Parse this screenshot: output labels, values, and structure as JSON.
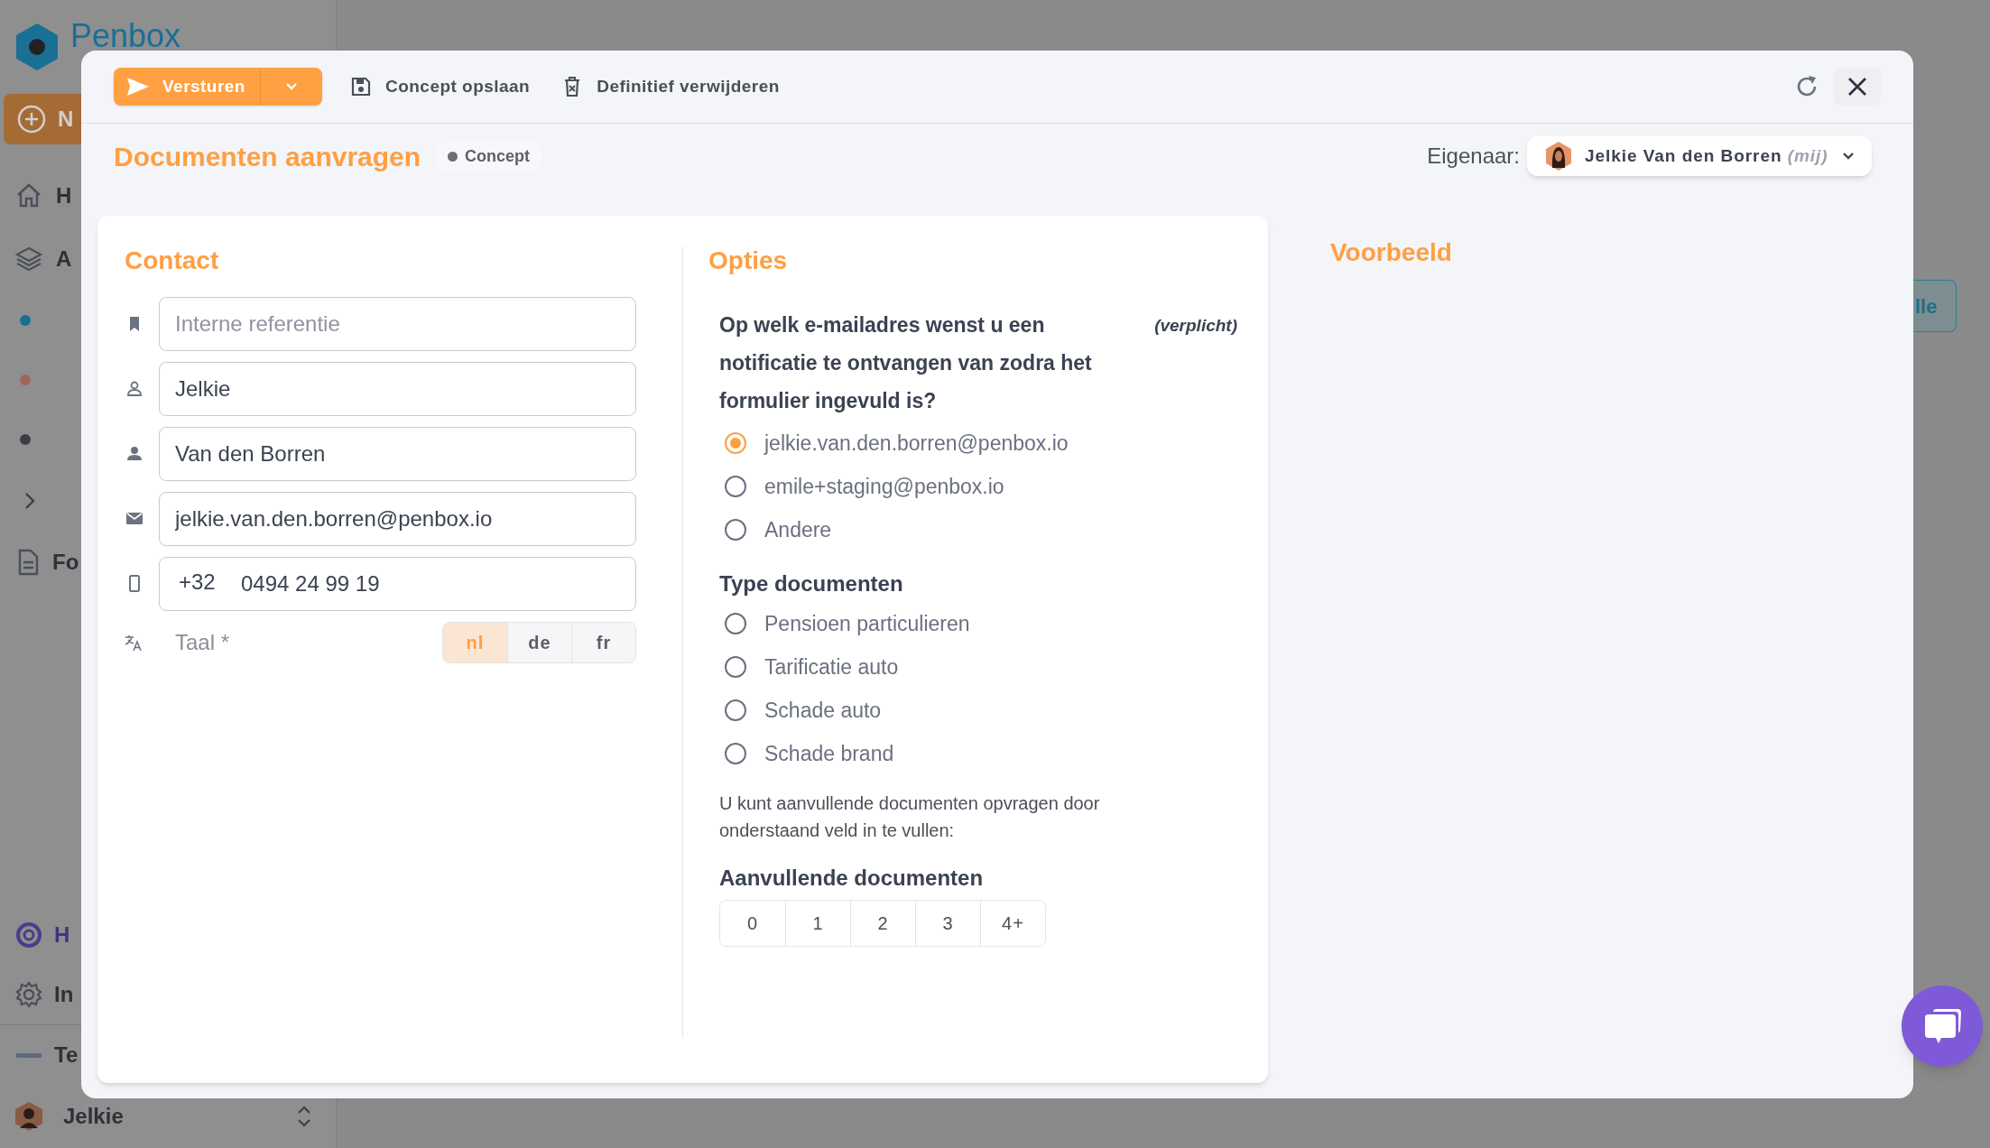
{
  "background": {
    "logo_text": "Penbox",
    "new_button": "N",
    "nav": [
      {
        "label": "H"
      },
      {
        "label": "A"
      }
    ],
    "sub_items": [
      {
        "color": "#1a6f94"
      },
      {
        "color": "#a0655a"
      },
      {
        "color": "#3b3f48"
      }
    ],
    "nav_bottom": [
      {
        "label": "Fo"
      }
    ],
    "footer_nav": [
      {
        "label": "H"
      },
      {
        "label": "In"
      },
      {
        "label": "Te"
      }
    ],
    "user": "Jelkie",
    "side_button": "lle"
  },
  "modal": {
    "send_button": "Versturen",
    "save_button": "Concept opslaan",
    "delete_button": "Definitief verwijderen",
    "title": "Documenten aanvragen",
    "status": "Concept",
    "owner_label": "Eigenaar:",
    "owner_name": "Jelkie Van den Borren",
    "owner_note": "(mij)",
    "contact": {
      "heading": "Contact",
      "fields": [
        {
          "placeholder": "Interne referentie"
        },
        {
          "value": "Jelkie"
        },
        {
          "value": "Van den Borren"
        },
        {
          "value": "jelkie.van.den.borren@penbox.io"
        },
        {
          "prefix": "+32",
          "value": "0494 24 99 19"
        }
      ],
      "language_label": "Taal *",
      "languages": [
        {
          "label": "nl",
          "selected": true
        },
        {
          "label": "de",
          "selected": false
        },
        {
          "label": "fr",
          "selected": false
        }
      ]
    },
    "options": {
      "heading": "Opties",
      "question": "Op welk e-mailadres wenst u een notificatie te ontvangen van zodra het formulier ingevuld is?",
      "required": "(verplicht)",
      "emails": [
        {
          "label": "jelkie.van.den.borren@penbox.io",
          "selected": true
        },
        {
          "label": "emile+staging@penbox.io",
          "selected": false
        },
        {
          "label": "Andere",
          "selected": false
        }
      ],
      "types_heading": "Type documenten",
      "types": [
        {
          "label": "Pensioen particulieren",
          "selected": false
        },
        {
          "label": "Tarificatie auto",
          "selected": false
        },
        {
          "label": "Schade auto",
          "selected": false
        },
        {
          "label": "Schade brand",
          "selected": false
        }
      ],
      "hint": "U kunt aanvullende documenten opvragen door onderstaand veld in te vullen:",
      "extra_heading": "Aanvullende documenten",
      "counts": [
        {
          "label": "0",
          "selected": false
        },
        {
          "label": "1",
          "selected": false
        },
        {
          "label": "2",
          "selected": false
        },
        {
          "label": "3",
          "selected": false
        },
        {
          "label": "4+",
          "selected": false
        }
      ]
    },
    "preview_heading": "Voorbeeld"
  }
}
